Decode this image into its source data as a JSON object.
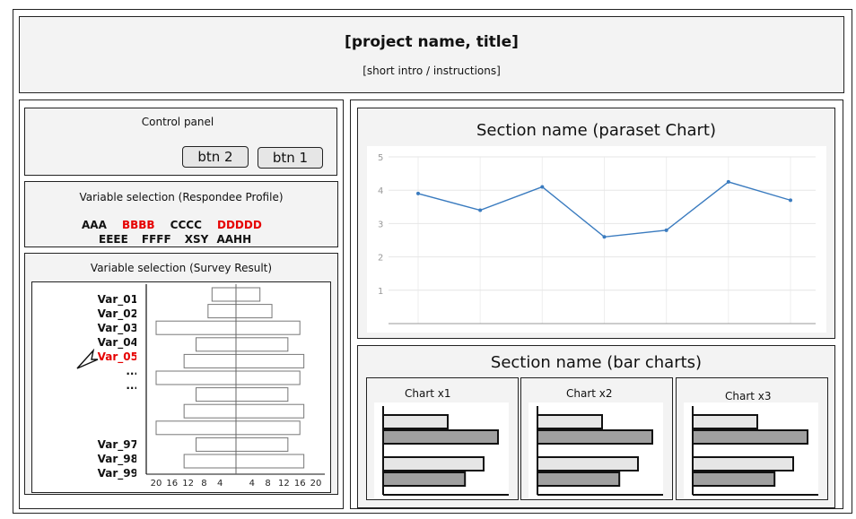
{
  "header": {
    "title": "[project name,  title]",
    "subtitle": "[short intro / instructions]"
  },
  "control_panel": {
    "title": "Control panel",
    "buttons": [
      "btn 2",
      "btn 1"
    ]
  },
  "variable_selection_profile": {
    "title": "Variable selection (Respondee Profile)",
    "row1": [
      {
        "label": "AAA",
        "selected": false
      },
      {
        "label": "BBBB",
        "selected": true
      },
      {
        "label": "CCCC",
        "selected": false
      },
      {
        "label": "DDDDD",
        "selected": true
      }
    ],
    "row2": [
      {
        "label": "EEEE",
        "selected": false
      },
      {
        "label": "FFFF",
        "selected": false
      },
      {
        "label": "XSY",
        "selected": false
      },
      {
        "label": "AAHH",
        "selected": false
      }
    ]
  },
  "variable_selection_survey": {
    "title": "Variable selection (Survey Result)",
    "variables": [
      "Var_01",
      "Var_02",
      "Var_03",
      "Var_04",
      "Var_05",
      "...",
      "...",
      "Var_97",
      "Var_98",
      "Var_99"
    ],
    "selected_variable": "Var_05",
    "axis_ticks": [
      "20",
      "16",
      "12",
      "8",
      "4",
      "",
      "4",
      "8",
      "12",
      "16",
      "20"
    ],
    "diverging_bars": [
      {
        "left": 6,
        "right": 6
      },
      {
        "left": 7,
        "right": 9
      },
      {
        "left": 20,
        "right": 16
      },
      {
        "left": 10,
        "right": 13
      },
      {
        "left": 13,
        "right": 17
      },
      {
        "left": 20,
        "right": 16
      },
      {
        "left": 10,
        "right": 13
      },
      {
        "left": 13,
        "right": 17
      },
      {
        "left": 20,
        "right": 16
      },
      {
        "left": 10,
        "right": 13
      },
      {
        "left": 13,
        "right": 17
      }
    ]
  },
  "section_parallel": {
    "title": "Section name (paraset Chart)"
  },
  "section_bars": {
    "title": "Section name (bar charts)",
    "charts": [
      {
        "title": "Chart x1"
      },
      {
        "title": "Chart x2"
      },
      {
        "title": "Chart x3"
      }
    ]
  },
  "chart_data": [
    {
      "type": "line",
      "x": [
        1,
        2,
        3,
        4,
        5,
        6,
        7
      ],
      "series": [
        {
          "values": [
            3.9,
            3.4,
            4.1,
            2.6,
            2.8,
            4.25,
            3.7
          ]
        }
      ],
      "ylim": [
        0,
        5
      ],
      "yticks": [
        "1",
        "2",
        "3",
        "4",
        "5"
      ],
      "grid": true,
      "color": "#3a7bbf"
    },
    {
      "type": "bar",
      "orientation": "horizontal",
      "values": [
        45,
        80,
        70,
        57
      ],
      "colors": [
        "#e6e6e6",
        "#a0a0a0",
        "#e6e6e6",
        "#a0a0a0"
      ]
    }
  ]
}
